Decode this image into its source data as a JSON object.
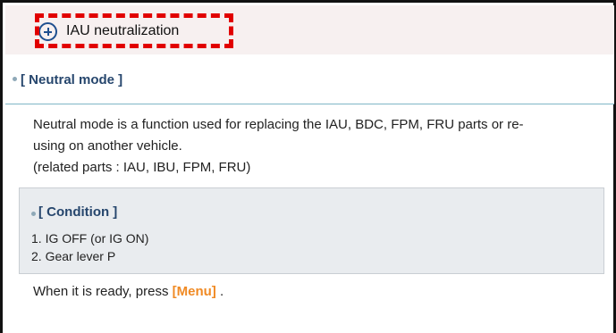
{
  "header": {
    "title": "IAU neutralization"
  },
  "section": {
    "heading": "[ Neutral mode ]",
    "paragraph1_line1": "Neutral mode is a function used for replacing the IAU, BDC, FPM, FRU parts or re-",
    "paragraph1_line2": "using on another vehicle.",
    "paragraph1_line3": "(related parts : IAU, IBU, FPM, FRU)"
  },
  "condition": {
    "title": "[ Condition ]",
    "items": [
      "1. IG OFF (or IG ON)",
      "2. Gear lever P"
    ]
  },
  "footer": {
    "prefix": "When it is ready, press ",
    "menu_label": "[Menu]",
    "suffix": " ."
  },
  "colors": {
    "accent": "#f08a24",
    "heading": "#26466d",
    "annotation": "#e10000"
  }
}
